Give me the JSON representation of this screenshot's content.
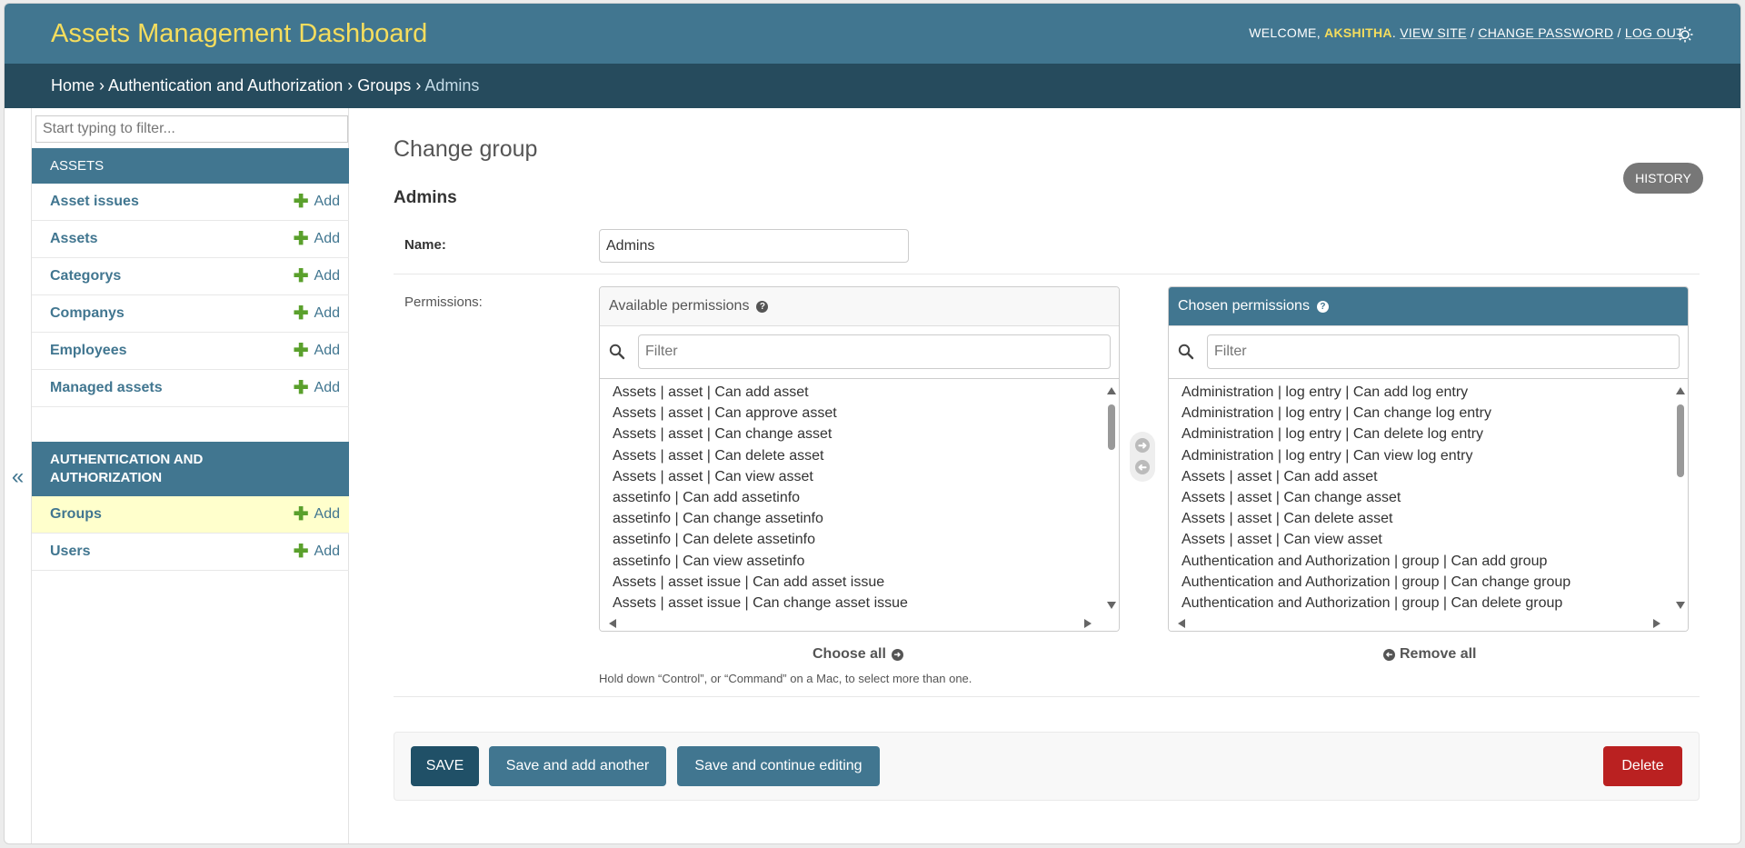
{
  "header": {
    "brand": "Assets Management Dashboard",
    "welcome": "WELCOME,",
    "username": "AKSHITHA",
    "view_site": "VIEW SITE",
    "change_password": "CHANGE PASSWORD",
    "log_out": "LOG OUT",
    "sep": "/"
  },
  "breadcrumbs": {
    "home": "Home",
    "app": "Authentication and Authorization",
    "model": "Groups",
    "current": "Admins",
    "sep": "›"
  },
  "sidebar": {
    "filter_placeholder": "Start typing to filter...",
    "collapse_glyph": "«",
    "add_label": "Add",
    "assets_caption": "ASSETS",
    "assets_models": [
      "Asset issues",
      "Assets",
      "Categorys",
      "Companys",
      "Employees",
      "Managed assets"
    ],
    "auth_caption_line1": "AUTHENTICATION AND",
    "auth_caption_line2": "AUTHORIZATION",
    "auth_models": [
      "Groups",
      "Users"
    ]
  },
  "content": {
    "page_title": "Change group",
    "history": "HISTORY",
    "object_title": "Admins",
    "name_label": "Name:",
    "name_value": "Admins",
    "permissions_label": "Permissions:",
    "available_title": "Available permissions",
    "chosen_title": "Chosen permissions",
    "filter_placeholder": "Filter",
    "available_items": [
      "Assets | asset | Can add asset",
      "Assets | asset | Can approve asset",
      "Assets | asset | Can change asset",
      "Assets | asset | Can delete asset",
      "Assets | asset | Can view asset",
      "assetinfo | Can add assetinfo",
      "assetinfo | Can change assetinfo",
      "assetinfo | Can delete assetinfo",
      "assetinfo | Can view assetinfo",
      "Assets | asset issue | Can add asset issue",
      "Assets | asset issue | Can change asset issue"
    ],
    "chosen_items": [
      "Administration | log entry | Can add log entry",
      "Administration | log entry | Can change log entry",
      "Administration | log entry | Can delete log entry",
      "Administration | log entry | Can view log entry",
      "Assets | asset | Can add asset",
      "Assets | asset | Can change asset",
      "Assets | asset | Can delete asset",
      "Assets | asset | Can view asset",
      "Authentication and Authorization | group | Can add group",
      "Authentication and Authorization | group | Can change group",
      "Authentication and Authorization | group | Can delete group"
    ],
    "choose_all": "Choose all",
    "remove_all": "Remove all",
    "help_text": "Hold down “Control”, or “Command” on a Mac, to select more than one.",
    "help_glyph": "?"
  },
  "buttons": {
    "save": "SAVE",
    "save_add_another": "Save and add another",
    "save_continue": "Save and continue editing",
    "delete": "Delete"
  },
  "colors": {
    "header": "#417690",
    "breadcrumbs": "#264b5d",
    "brand_text": "#f5dd5d",
    "delete": "#ba2121",
    "add_plus": "#5aa02c"
  }
}
